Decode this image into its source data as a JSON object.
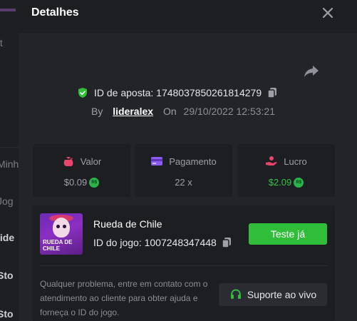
{
  "background": {
    "words": [
      "ft",
      "Minh",
      "Jog",
      "lide",
      "Sto",
      "Sto"
    ]
  },
  "modal": {
    "title": "Detalhes",
    "bet": {
      "id_label": "ID de aposta: 1748037850261814279",
      "by_label": "By",
      "username": "lideralex",
      "on_label": "On",
      "datetime": "29/10/2022 12:53:21"
    },
    "stats": [
      {
        "label": "Valor",
        "value": "$0.09",
        "coin": "R$",
        "icon": "money-bag-icon"
      },
      {
        "label": "Pagamento",
        "value": "22 x",
        "icon": "credit-card-icon"
      },
      {
        "label": "Lucro",
        "value": "$2.09",
        "coin": "R$",
        "icon": "hand-coins-icon"
      }
    ],
    "game": {
      "name": "Rueda de Chile",
      "id_label": "ID do jogo: 1007248347448",
      "thumb_line1": "RUEDA DE",
      "thumb_line2": "CHILE",
      "play_button": "Teste já"
    },
    "help_text": "Qualquer problema, entre em contato com o atendimento ao cliente para obter ajuda e forneça o ID do jogo.",
    "support_button": "Suporte ao vivo"
  },
  "colors": {
    "accent_green": "#2fbd3a",
    "profit_green": "#35c24a",
    "valor_icon": "#e8456b",
    "pagamento_icon": "#8a5cf0",
    "lucro_icon": "#e8456b",
    "shield_green": "#2fbd3a"
  }
}
